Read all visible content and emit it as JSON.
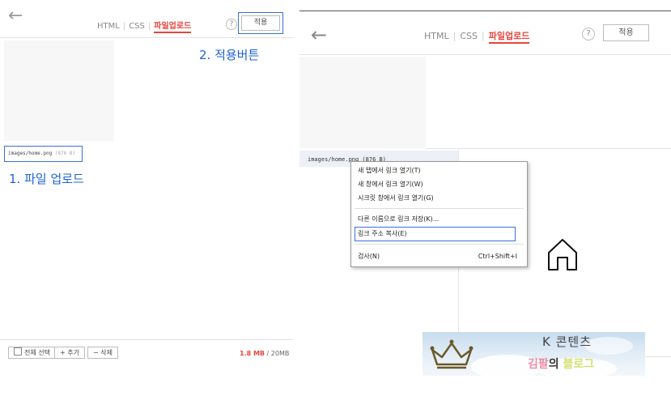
{
  "left": {
    "tabs": [
      "HTML",
      "CSS",
      "파일업로드"
    ],
    "help_icon": "?",
    "apply_label": "적용",
    "file_path": "images/home.png",
    "file_size": "(876 B)",
    "annotation_apply": "2. 적용버튼",
    "annotation_upload": "1. 파일 업로드",
    "select_all_label": "전체 선택",
    "add_label": "+ 추가",
    "delete_label": "− 삭제",
    "usage_used": "1.8 MB",
    "usage_total": " / 20MB"
  },
  "right": {
    "tabs": [
      "HTML",
      "CSS",
      "파일업로드"
    ],
    "help_icon": "?",
    "apply_label": "적용",
    "file_path": "images/home.png (876 B)",
    "context_menu": {
      "items": [
        "새 탭에서 링크 열기(T)",
        "새 창에서 링크 열기(W)",
        "시크릿 창에서 링크 열기(G)",
        "다른 이름으로 링크 저장(K)...",
        "링크 주소 복사(E)",
        "검사(N)"
      ],
      "inspect_shortcut": "Ctrl+Shift+I",
      "highlighted_item": "링크 주소 복사(E)"
    },
    "home_icon": "home-icon"
  },
  "logo": {
    "line1": "K 콘텐츠",
    "line2_part1": "김팔",
    "line2_part2": "의",
    "line2_part3": "블로그"
  },
  "colors": {
    "accent_red": "#e8453c",
    "annotation_blue": "#1c62d6"
  }
}
